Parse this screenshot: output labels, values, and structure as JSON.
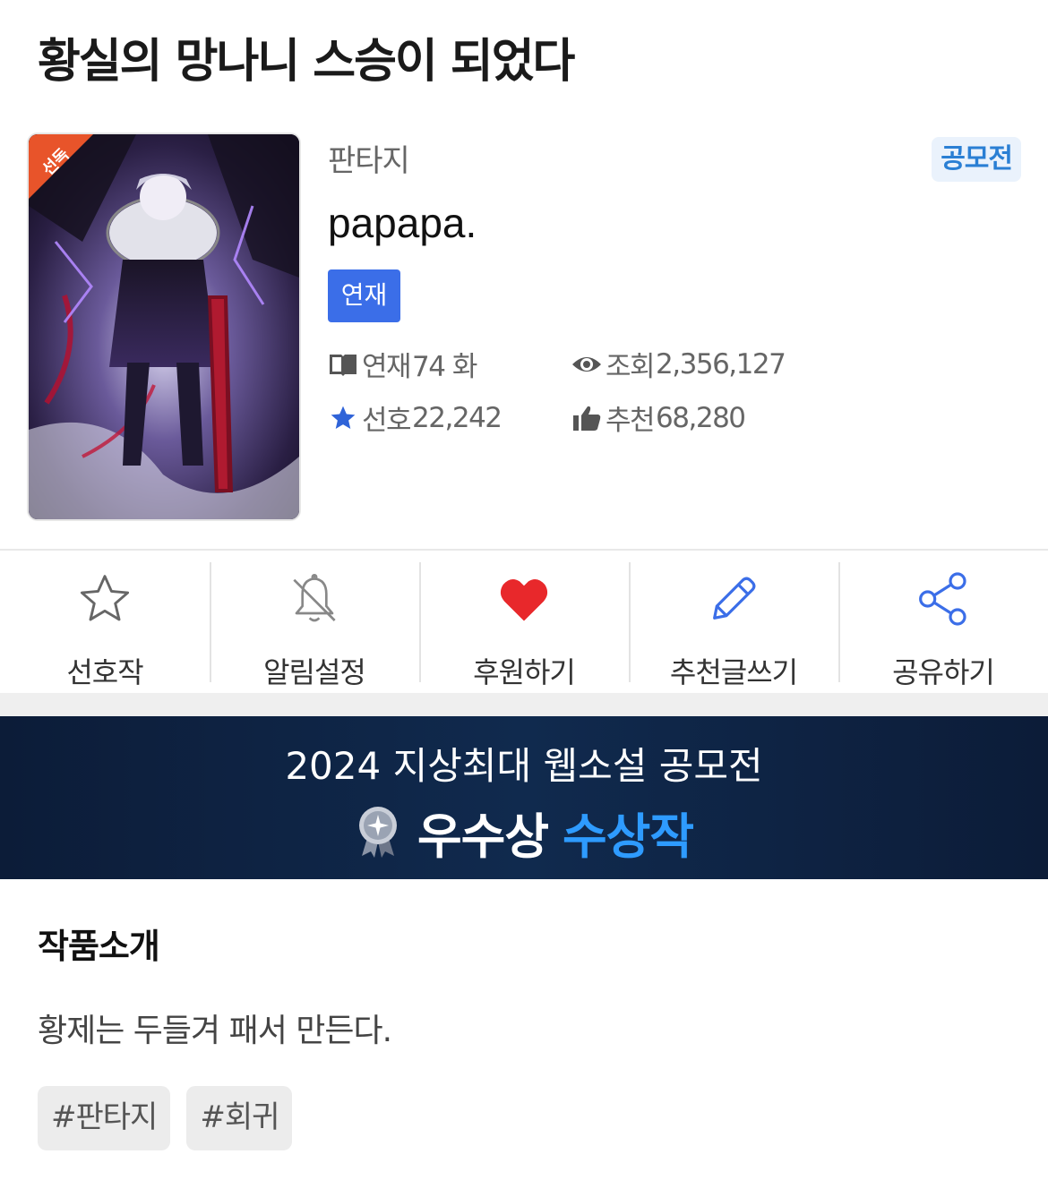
{
  "novel": {
    "title": "황실의 망나니 스승이 되었다",
    "genre": "판타지",
    "contest_badge": "공모전",
    "author": "papapa.",
    "status": "연재",
    "cover_ribbon": "선독"
  },
  "stats": {
    "episodes_label": "연재",
    "episodes_value": "74 화",
    "views_label": "조회",
    "views_value": "2,356,127",
    "favorites_label": "선호",
    "favorites_value": "22,242",
    "recommend_label": "추천",
    "recommend_value": "68,280"
  },
  "actions": {
    "favorite": "선호작",
    "notify": "알림설정",
    "support": "후원하기",
    "write_review": "추천글쓰기",
    "share": "공유하기"
  },
  "banner": {
    "line1": "2024 지상최대 웹소설 공모전",
    "award": "우수상",
    "winner": "수상작"
  },
  "intro": {
    "heading": "작품소개",
    "text": "황제는 두들겨 패서 만든다.",
    "tags": [
      "#판타지",
      "#회귀"
    ]
  },
  "colors": {
    "accent_blue": "#3b6ee8",
    "contest_blue": "#2a7fd4",
    "heart_red": "#e8282b",
    "banner_bg": "#0c1c38",
    "winner_blue": "#2e9bff"
  },
  "icons": [
    "book-icon",
    "eye-icon",
    "star-icon",
    "thumbs-up-icon",
    "star-outline-icon",
    "bell-off-icon",
    "heart-icon",
    "pencil-icon",
    "share-icon",
    "medal-icon"
  ]
}
